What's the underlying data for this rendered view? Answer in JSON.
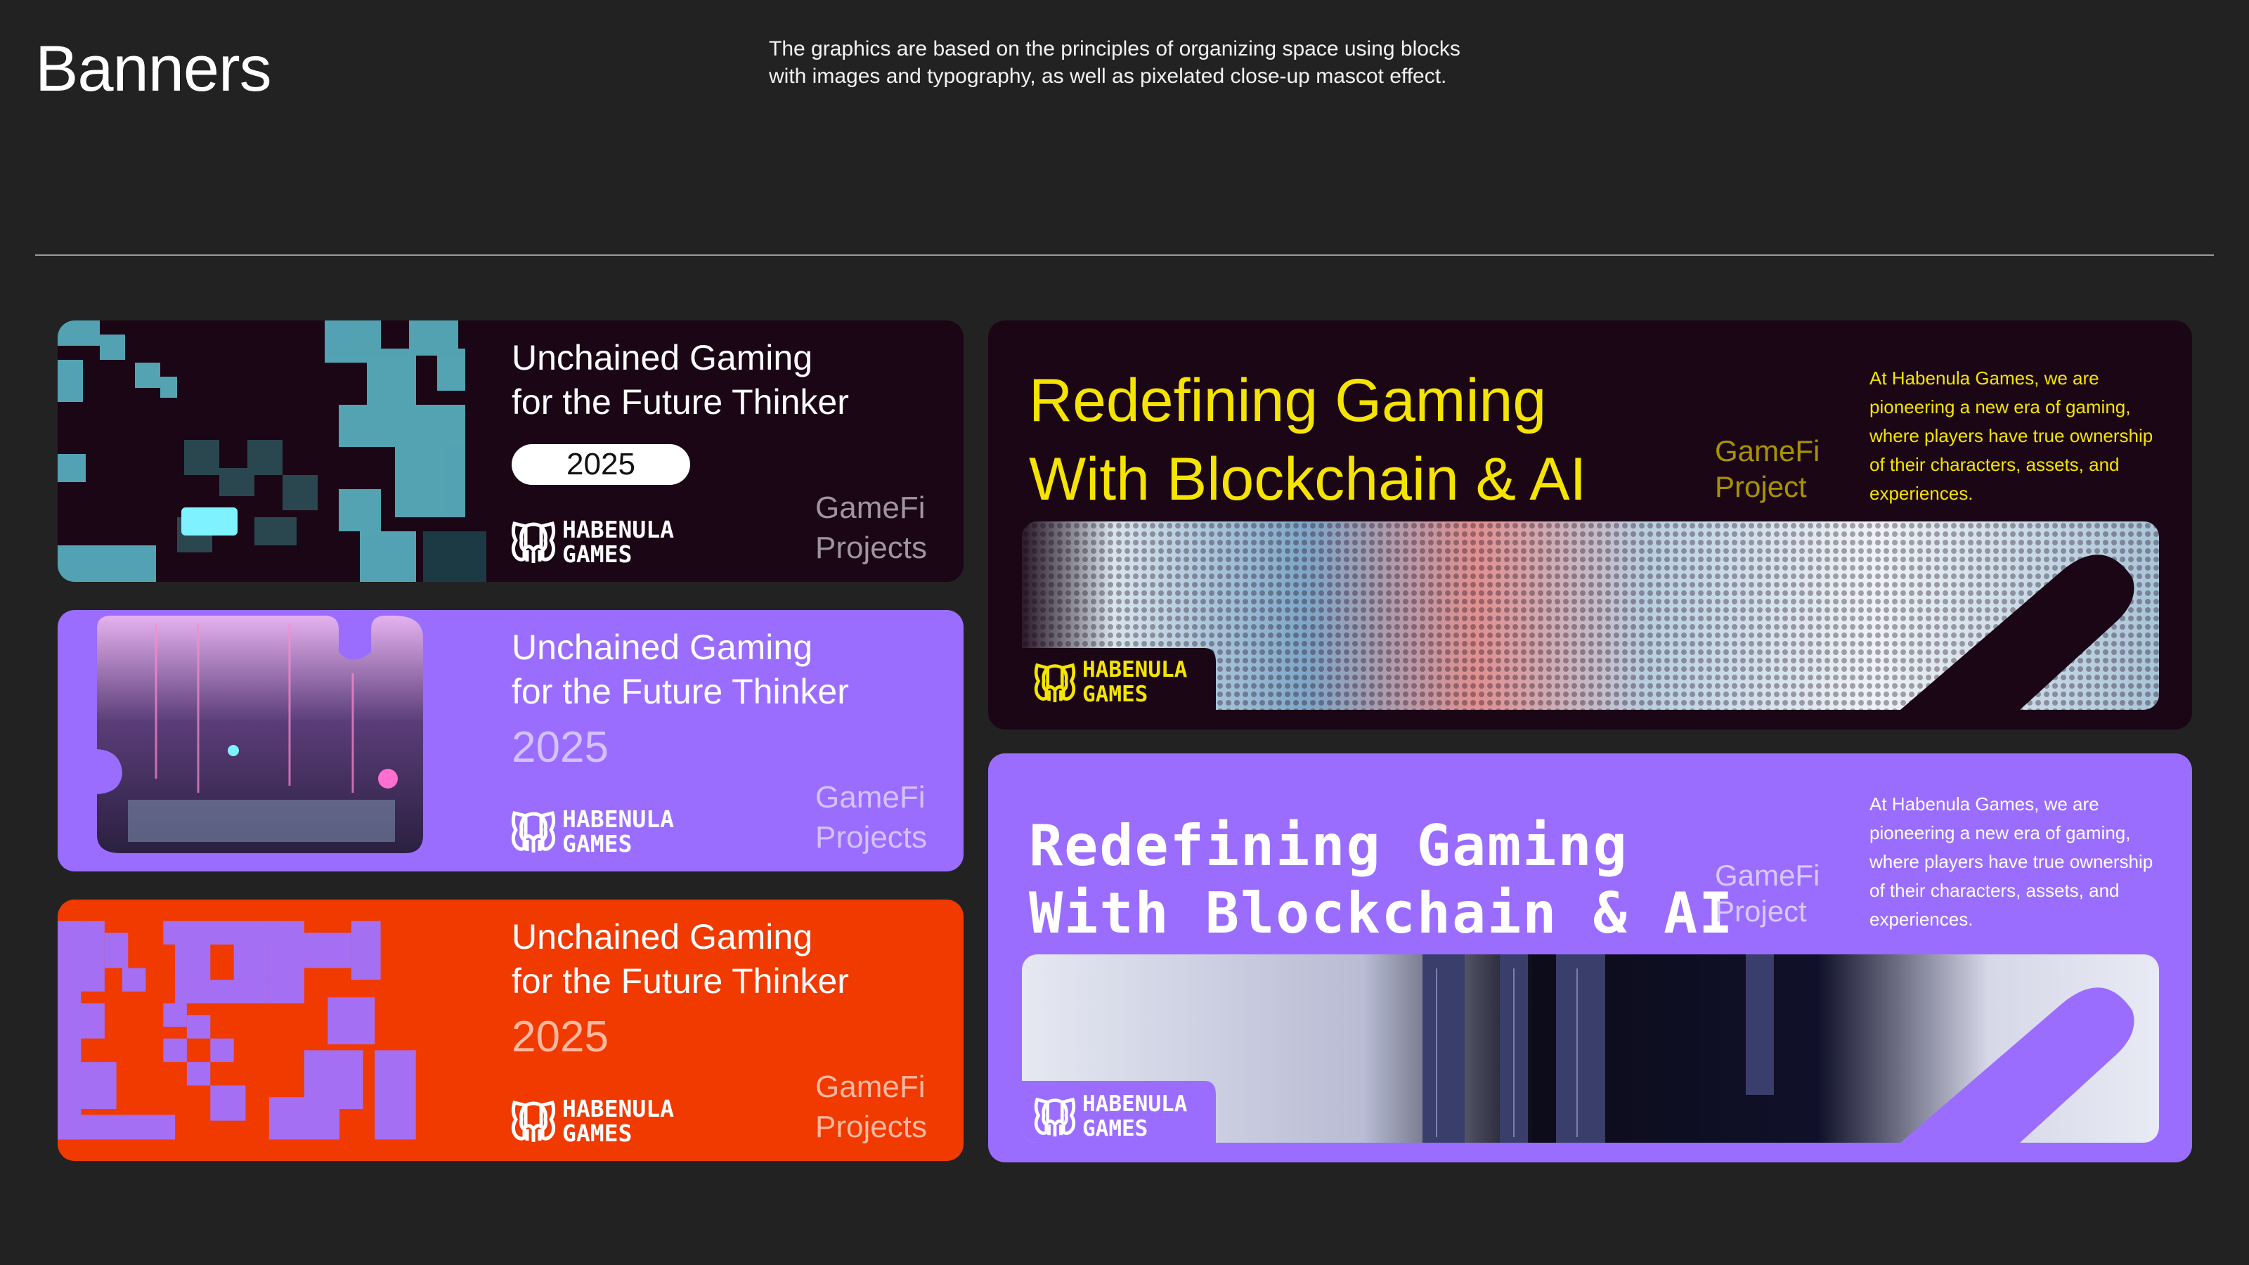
{
  "header": {
    "title": "Banners",
    "description": "The graphics are based on the principles of organizing space using blocks with images and typography, as well as pixelated close-up mascot effect."
  },
  "small_banners": [
    {
      "title_line1": "Unchained Gaming",
      "title_line2": "for the Future Thinker",
      "year": "2025",
      "logo_line1": "HABENULA",
      "logo_line2": "GAMES",
      "tag_line1": "GameFi",
      "tag_line2": "Projects",
      "background": "#1b0616"
    },
    {
      "title_line1": "Unchained Gaming",
      "title_line2": "for the Future Thinker",
      "year": "2025",
      "logo_line1": "HABENULA",
      "logo_line2": "GAMES",
      "tag_line1": "GameFi",
      "tag_line2": "Projects",
      "background": "#9a6dff"
    },
    {
      "title_line1": "Unchained Gaming",
      "title_line2": "for the Future Thinker",
      "year": "2025",
      "logo_line1": "HABENULA",
      "logo_line2": "GAMES",
      "tag_line1": "GameFi",
      "tag_line2": "Projects",
      "background": "#f03a00"
    }
  ],
  "large_banners": [
    {
      "title_line1": "Redefining Gaming",
      "title_line2": "With Blockchain & AI",
      "tag_line1": "GameFi",
      "tag_line2": "Project",
      "description": "At Habenula Games, we are pioneering a new era of gaming, where players have true ownership of their characters, assets, and experiences.",
      "logo_line1": "HABENULA",
      "logo_line2": "GAMES",
      "accent": "#f5e400",
      "background": "#1b0616"
    },
    {
      "title_line1": "Redefining Gaming",
      "title_line2": "With Blockchain & AI",
      "tag_line1": "GameFi",
      "tag_line2": "Project",
      "description": "At Habenula Games, we are pioneering a new era of gaming, where players have true ownership of their characters, assets, and experiences.",
      "logo_line1": "HABENULA",
      "logo_line2": "GAMES",
      "accent": "#ffffff",
      "background": "#9a6dff"
    }
  ],
  "icons": {
    "logo": "habenula-mascot-logo-icon"
  }
}
